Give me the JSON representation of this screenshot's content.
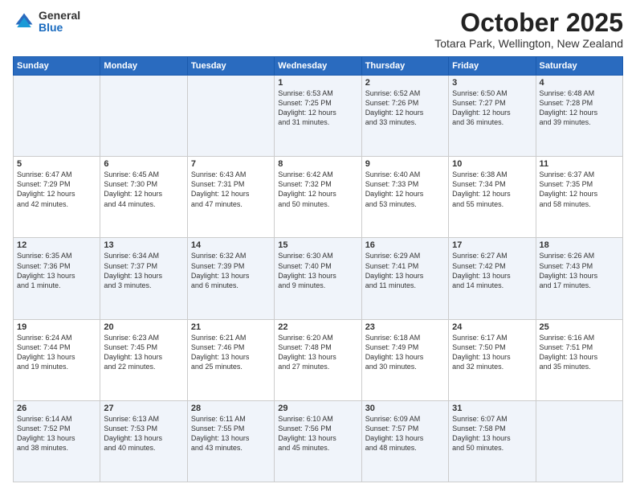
{
  "header": {
    "logo_general": "General",
    "logo_blue": "Blue",
    "month_title": "October 2025",
    "location": "Totara Park, Wellington, New Zealand"
  },
  "days_of_week": [
    "Sunday",
    "Monday",
    "Tuesday",
    "Wednesday",
    "Thursday",
    "Friday",
    "Saturday"
  ],
  "weeks": [
    [
      {
        "day": "",
        "info": ""
      },
      {
        "day": "",
        "info": ""
      },
      {
        "day": "",
        "info": ""
      },
      {
        "day": "1",
        "info": "Sunrise: 6:53 AM\nSunset: 7:25 PM\nDaylight: 12 hours\nand 31 minutes."
      },
      {
        "day": "2",
        "info": "Sunrise: 6:52 AM\nSunset: 7:26 PM\nDaylight: 12 hours\nand 33 minutes."
      },
      {
        "day": "3",
        "info": "Sunrise: 6:50 AM\nSunset: 7:27 PM\nDaylight: 12 hours\nand 36 minutes."
      },
      {
        "day": "4",
        "info": "Sunrise: 6:48 AM\nSunset: 7:28 PM\nDaylight: 12 hours\nand 39 minutes."
      }
    ],
    [
      {
        "day": "5",
        "info": "Sunrise: 6:47 AM\nSunset: 7:29 PM\nDaylight: 12 hours\nand 42 minutes."
      },
      {
        "day": "6",
        "info": "Sunrise: 6:45 AM\nSunset: 7:30 PM\nDaylight: 12 hours\nand 44 minutes."
      },
      {
        "day": "7",
        "info": "Sunrise: 6:43 AM\nSunset: 7:31 PM\nDaylight: 12 hours\nand 47 minutes."
      },
      {
        "day": "8",
        "info": "Sunrise: 6:42 AM\nSunset: 7:32 PM\nDaylight: 12 hours\nand 50 minutes."
      },
      {
        "day": "9",
        "info": "Sunrise: 6:40 AM\nSunset: 7:33 PM\nDaylight: 12 hours\nand 53 minutes."
      },
      {
        "day": "10",
        "info": "Sunrise: 6:38 AM\nSunset: 7:34 PM\nDaylight: 12 hours\nand 55 minutes."
      },
      {
        "day": "11",
        "info": "Sunrise: 6:37 AM\nSunset: 7:35 PM\nDaylight: 12 hours\nand 58 minutes."
      }
    ],
    [
      {
        "day": "12",
        "info": "Sunrise: 6:35 AM\nSunset: 7:36 PM\nDaylight: 13 hours\nand 1 minute."
      },
      {
        "day": "13",
        "info": "Sunrise: 6:34 AM\nSunset: 7:37 PM\nDaylight: 13 hours\nand 3 minutes."
      },
      {
        "day": "14",
        "info": "Sunrise: 6:32 AM\nSunset: 7:39 PM\nDaylight: 13 hours\nand 6 minutes."
      },
      {
        "day": "15",
        "info": "Sunrise: 6:30 AM\nSunset: 7:40 PM\nDaylight: 13 hours\nand 9 minutes."
      },
      {
        "day": "16",
        "info": "Sunrise: 6:29 AM\nSunset: 7:41 PM\nDaylight: 13 hours\nand 11 minutes."
      },
      {
        "day": "17",
        "info": "Sunrise: 6:27 AM\nSunset: 7:42 PM\nDaylight: 13 hours\nand 14 minutes."
      },
      {
        "day": "18",
        "info": "Sunrise: 6:26 AM\nSunset: 7:43 PM\nDaylight: 13 hours\nand 17 minutes."
      }
    ],
    [
      {
        "day": "19",
        "info": "Sunrise: 6:24 AM\nSunset: 7:44 PM\nDaylight: 13 hours\nand 19 minutes."
      },
      {
        "day": "20",
        "info": "Sunrise: 6:23 AM\nSunset: 7:45 PM\nDaylight: 13 hours\nand 22 minutes."
      },
      {
        "day": "21",
        "info": "Sunrise: 6:21 AM\nSunset: 7:46 PM\nDaylight: 13 hours\nand 25 minutes."
      },
      {
        "day": "22",
        "info": "Sunrise: 6:20 AM\nSunset: 7:48 PM\nDaylight: 13 hours\nand 27 minutes."
      },
      {
        "day": "23",
        "info": "Sunrise: 6:18 AM\nSunset: 7:49 PM\nDaylight: 13 hours\nand 30 minutes."
      },
      {
        "day": "24",
        "info": "Sunrise: 6:17 AM\nSunset: 7:50 PM\nDaylight: 13 hours\nand 32 minutes."
      },
      {
        "day": "25",
        "info": "Sunrise: 6:16 AM\nSunset: 7:51 PM\nDaylight: 13 hours\nand 35 minutes."
      }
    ],
    [
      {
        "day": "26",
        "info": "Sunrise: 6:14 AM\nSunset: 7:52 PM\nDaylight: 13 hours\nand 38 minutes."
      },
      {
        "day": "27",
        "info": "Sunrise: 6:13 AM\nSunset: 7:53 PM\nDaylight: 13 hours\nand 40 minutes."
      },
      {
        "day": "28",
        "info": "Sunrise: 6:11 AM\nSunset: 7:55 PM\nDaylight: 13 hours\nand 43 minutes."
      },
      {
        "day": "29",
        "info": "Sunrise: 6:10 AM\nSunset: 7:56 PM\nDaylight: 13 hours\nand 45 minutes."
      },
      {
        "day": "30",
        "info": "Sunrise: 6:09 AM\nSunset: 7:57 PM\nDaylight: 13 hours\nand 48 minutes."
      },
      {
        "day": "31",
        "info": "Sunrise: 6:07 AM\nSunset: 7:58 PM\nDaylight: 13 hours\nand 50 minutes."
      },
      {
        "day": "",
        "info": ""
      }
    ]
  ]
}
